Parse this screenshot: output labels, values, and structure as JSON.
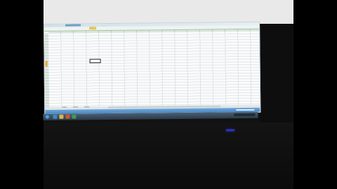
{
  "application": {
    "name": "spreadsheet",
    "ribbon_tabs": [
      "",
      "",
      "",
      "",
      "",
      "",
      ""
    ],
    "sheet_tabs": [
      "Sheet1",
      "Sheet2",
      "Sheet3"
    ],
    "cells": [
      {
        "ref": "B2",
        "value": ""
      },
      {
        "ref": "B4",
        "value": ""
      },
      {
        "ref": "B5",
        "value": ""
      },
      {
        "ref": "B6",
        "value": ""
      },
      {
        "ref": "B7",
        "value": ""
      }
    ],
    "selected_cell": "C10"
  },
  "taskbar": {
    "icons": [
      "start-orb-icon",
      "ie-icon",
      "folder-icon",
      "media-icon",
      "excel-icon"
    ]
  },
  "colors": {
    "ribbon_accent": "#a6c48f",
    "status_bar": "#4a86c2",
    "selection_border": "#222222",
    "led": "#2d34d8"
  }
}
